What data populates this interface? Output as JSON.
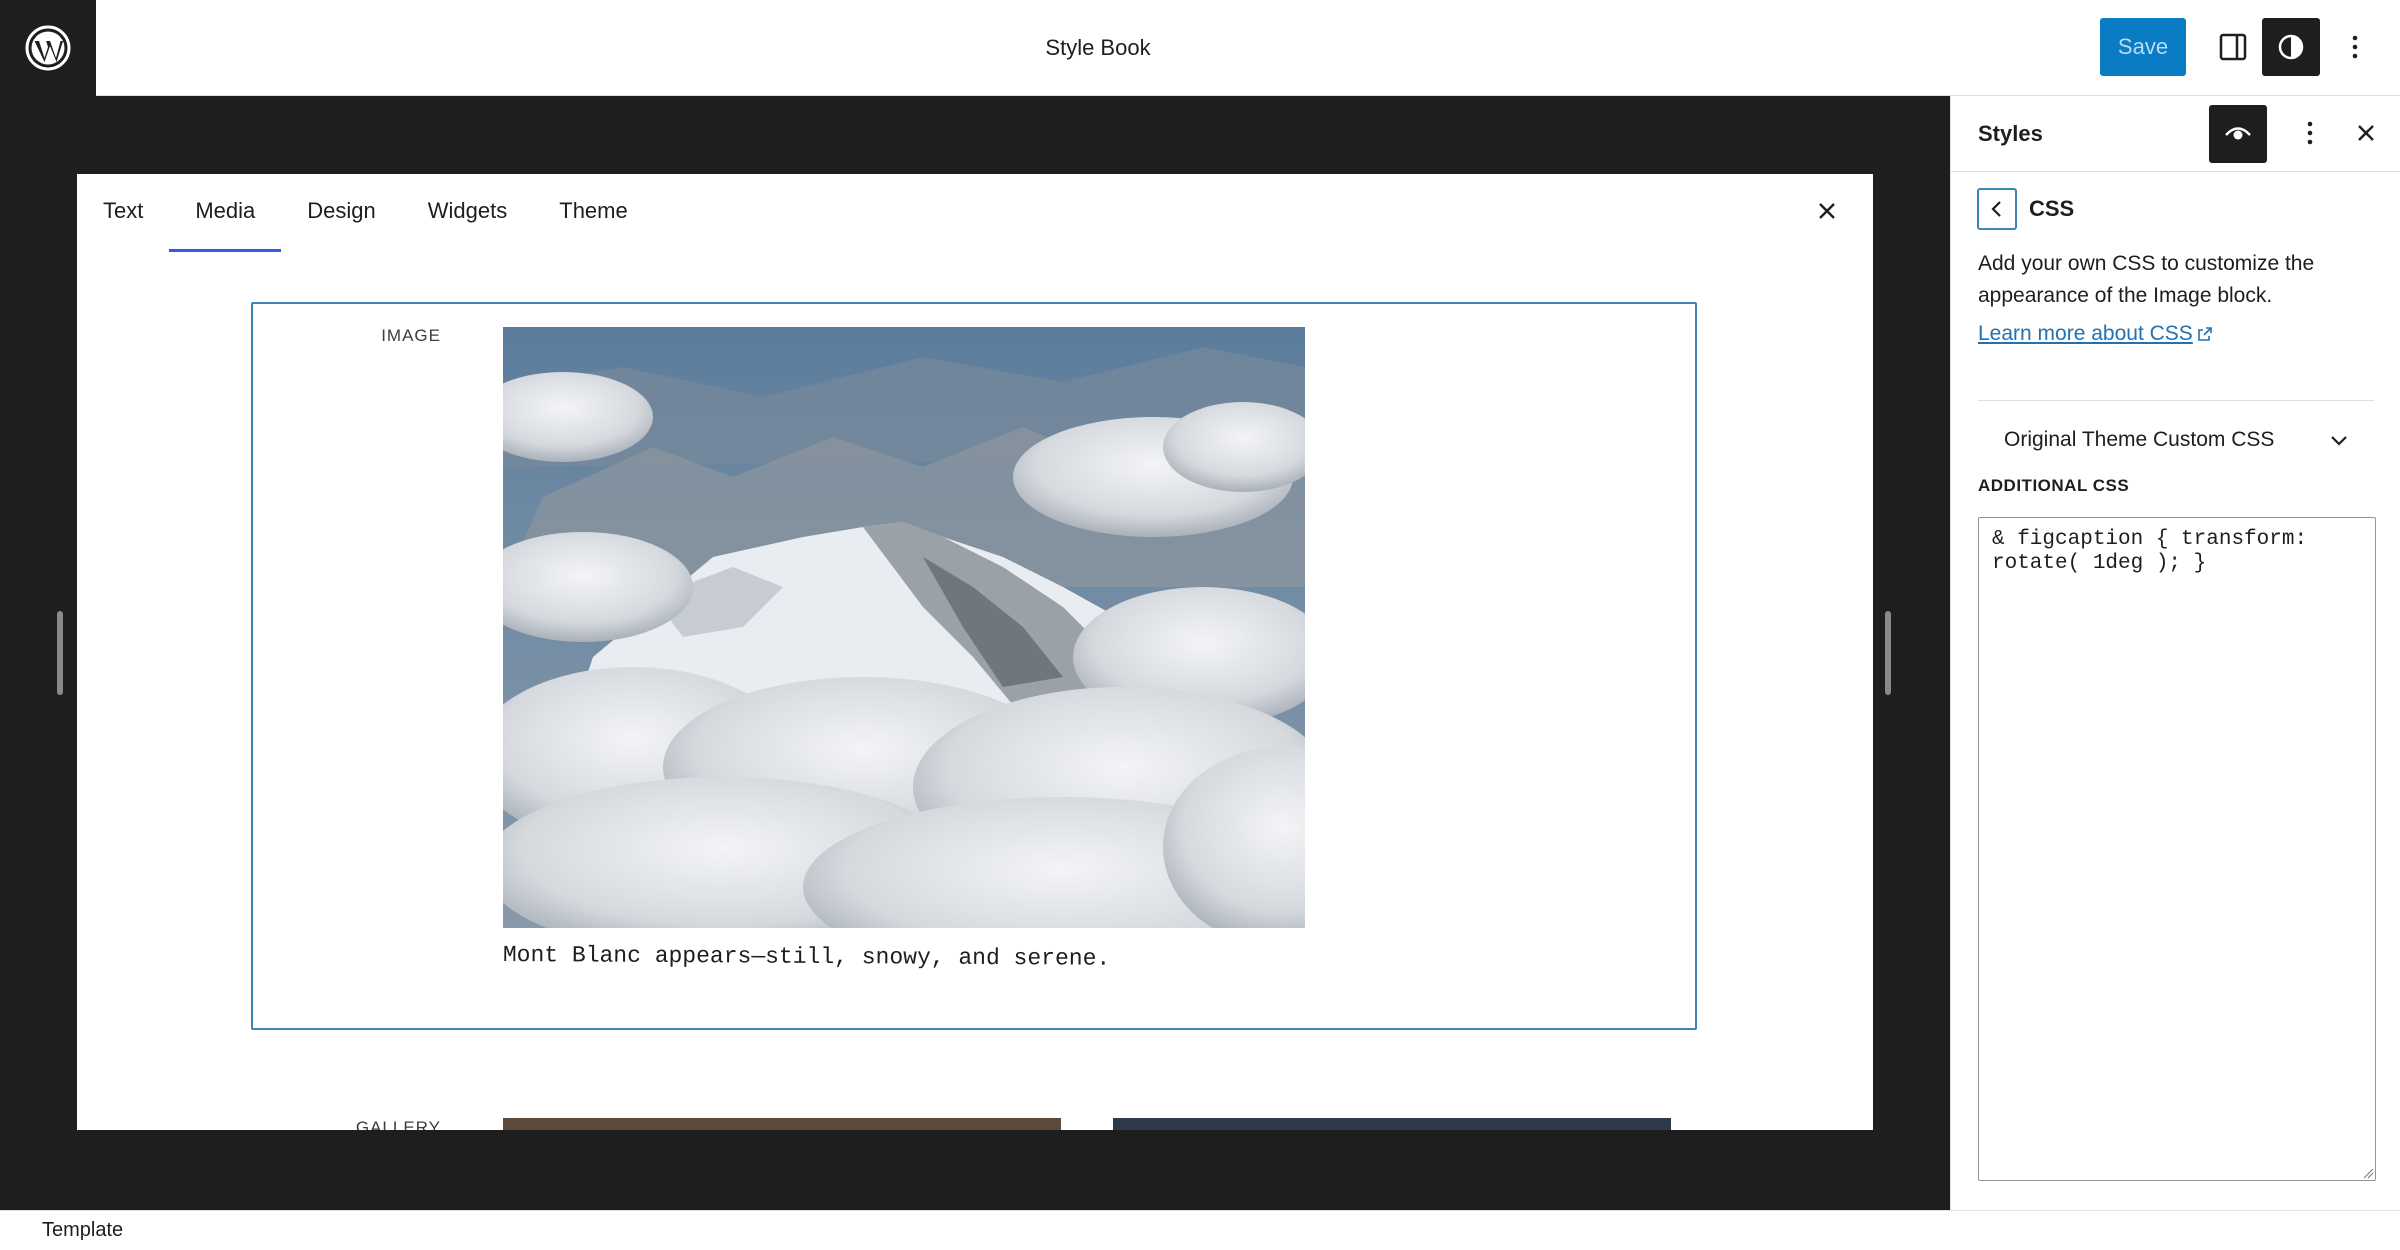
{
  "topbar": {
    "title": "Style Book",
    "save_label": "Save"
  },
  "stylebook": {
    "tabs": [
      {
        "label": "Text"
      },
      {
        "label": "Media"
      },
      {
        "label": "Design"
      },
      {
        "label": "Widgets"
      },
      {
        "label": "Theme"
      }
    ],
    "active_tab": "Media",
    "image_label": "IMAGE",
    "image_caption": "Mont Blanc appears—still, snowy, and serene.",
    "gallery_label": "GALLERY"
  },
  "sidebar": {
    "title": "Styles",
    "panel_title": "CSS",
    "description": "Add your own CSS to customize the appearance of the Image block.",
    "learn_more": "Learn more about CSS",
    "accordion_label": "Original Theme Custom CSS",
    "additional_css_label": "ADDITIONAL CSS",
    "css_value": "& figcaption { transform: rotate( 1deg ); }"
  },
  "footer": {
    "breadcrumb": "Template"
  },
  "colors": {
    "accent": "#3858e9",
    "save_button": "#0a7cc4",
    "focus_border": "#3a87b5",
    "link": "#2271b1",
    "dark": "#1e1e1e"
  },
  "icons": [
    "wordpress-logo",
    "sidebar-toggle-icon",
    "styles-contrast-icon",
    "more-vertical-icon",
    "close-icon",
    "eye-icon",
    "chevron-left-icon",
    "chevron-down-icon",
    "external-link-icon"
  ]
}
